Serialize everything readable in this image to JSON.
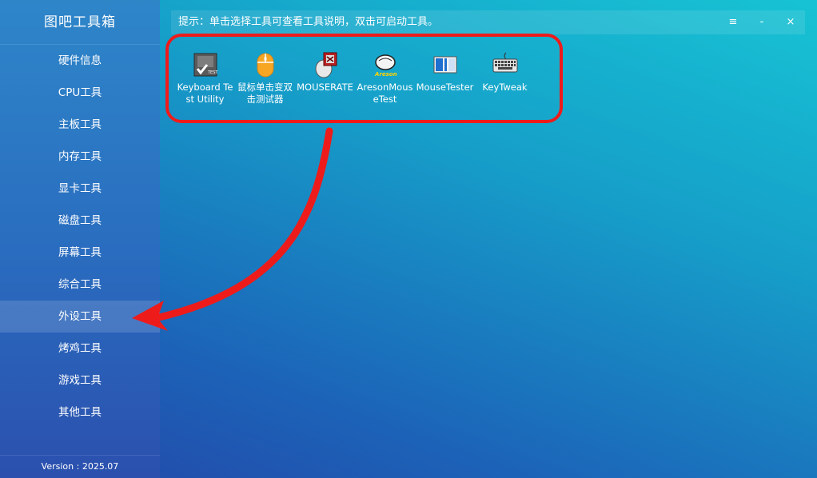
{
  "app": {
    "title": "图吧工具箱",
    "version": "Version : 2025.07"
  },
  "sidebar": {
    "items": [
      {
        "label": "硬件信息"
      },
      {
        "label": "CPU工具"
      },
      {
        "label": "主板工具"
      },
      {
        "label": "内存工具"
      },
      {
        "label": "显卡工具"
      },
      {
        "label": "磁盘工具"
      },
      {
        "label": "屏幕工具"
      },
      {
        "label": "综合工具"
      },
      {
        "label": "外设工具",
        "active": true
      },
      {
        "label": "烤鸡工具"
      },
      {
        "label": "游戏工具"
      },
      {
        "label": "其他工具"
      }
    ]
  },
  "hint": {
    "text": "提示：单击选择工具可查看工具说明，双击可启动工具。"
  },
  "window_controls": {
    "menu": "≡",
    "minimize": "-",
    "close": "×"
  },
  "tools": [
    {
      "label": "Keyboard Test Utility",
      "icon": "keyboard-test-icon"
    },
    {
      "label": "鼠标单击变双击测试器",
      "icon": "mouse-click-test-icon"
    },
    {
      "label": "MOUSERATE",
      "icon": "mouserate-icon"
    },
    {
      "label": "AresonMouseTest",
      "icon": "areson-mouse-icon"
    },
    {
      "label": "MouseTester",
      "icon": "mousetester-icon"
    },
    {
      "label": "KeyTweak",
      "icon": "keytweak-icon"
    }
  ],
  "colors": {
    "highlight_border": "#ee1b1b",
    "annotation_arrow": "#ee1b1b"
  }
}
